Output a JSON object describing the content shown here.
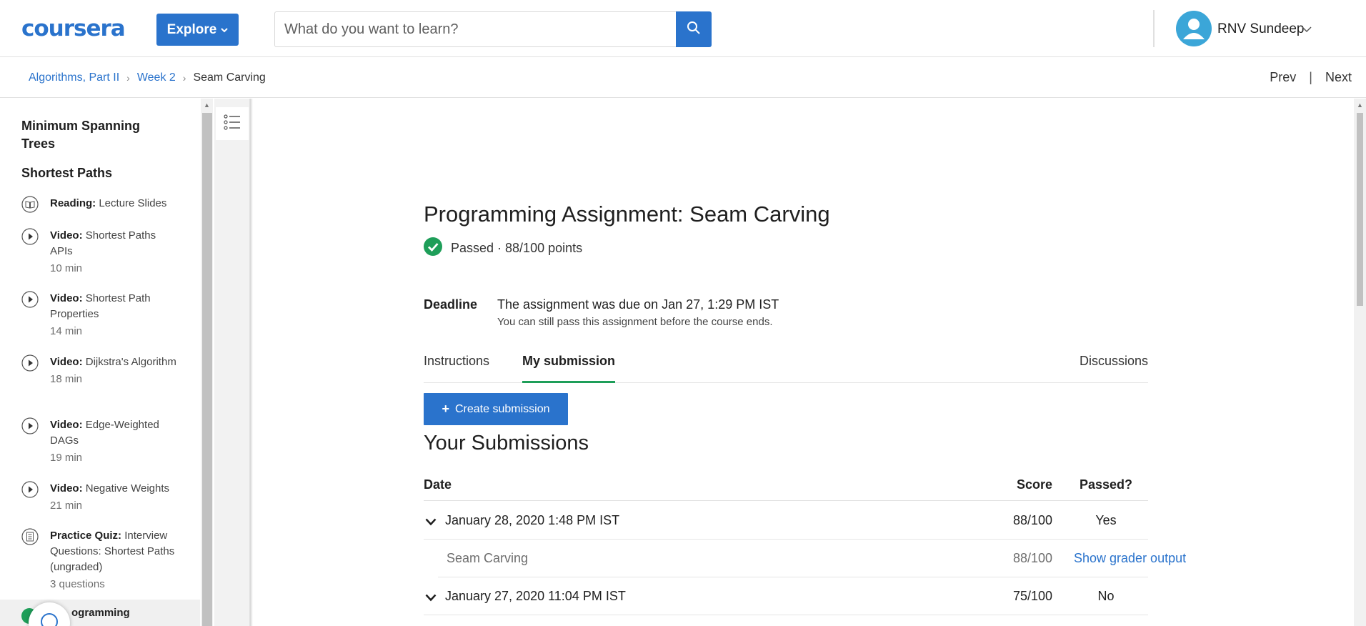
{
  "header": {
    "logo": "coursera",
    "explore_label": "Explore",
    "search_placeholder": "What do you want to learn?",
    "user_name": "RNV Sundeep",
    "accent": "#2a73cc"
  },
  "breadcrumb": {
    "items": [
      "Algorithms, Part II",
      "Week 2"
    ],
    "current": "Seam Carving",
    "prev": "Prev",
    "separator": "|",
    "next": "Next"
  },
  "sidebar": {
    "headings": [
      "Minimum Spanning Trees",
      "Shortest Paths"
    ],
    "items": [
      {
        "type": "Reading:",
        "title": "Lecture Slides",
        "meta": "",
        "icon": "book-icon"
      },
      {
        "type": "Video:",
        "title": "Shortest Paths APIs",
        "meta": "10 min",
        "icon": "play-icon"
      },
      {
        "type": "Video:",
        "title": "Shortest Path Properties",
        "meta": "14 min",
        "icon": "play-icon"
      },
      {
        "type": "Video:",
        "title": "Dijkstra's Algorithm",
        "meta": "18 min",
        "icon": "play-icon"
      },
      {
        "type": "Video:",
        "title": "Edge-Weighted DAGs",
        "meta": "19 min",
        "icon": "play-icon"
      },
      {
        "type": "Video:",
        "title": "Negative Weights",
        "meta": "21 min",
        "icon": "play-icon"
      },
      {
        "type": "Practice Quiz:",
        "title": "Interview Questions: Shortest Paths (ungraded)",
        "meta": "3 questions",
        "icon": "quiz-icon"
      }
    ],
    "active_item": "ogramming"
  },
  "main": {
    "title": "Programming Assignment: Seam Carving",
    "status": "Passed · 88/100 points",
    "status_color": "#1e9e59",
    "deadline_label": "Deadline",
    "deadline_text": "The assignment was due on Jan 27, 1:29 PM IST",
    "deadline_note": "You can still pass this assignment before the course ends.",
    "tabs": [
      "Instructions",
      "My submission",
      "Discussions"
    ],
    "active_tab": "My submission",
    "create_label": "Create submission",
    "submissions_title": "Your Submissions",
    "columns": [
      "Date",
      "Score",
      "Passed?"
    ],
    "rows": [
      {
        "date": "January 28, 2020 1:48 PM IST",
        "score": "88/100",
        "passed": "Yes"
      },
      {
        "part": "Seam Carving",
        "score": "88/100",
        "link": "Show grader output"
      },
      {
        "date": "January 27, 2020 11:04 PM IST",
        "score": "75/100",
        "passed": "No"
      }
    ]
  }
}
